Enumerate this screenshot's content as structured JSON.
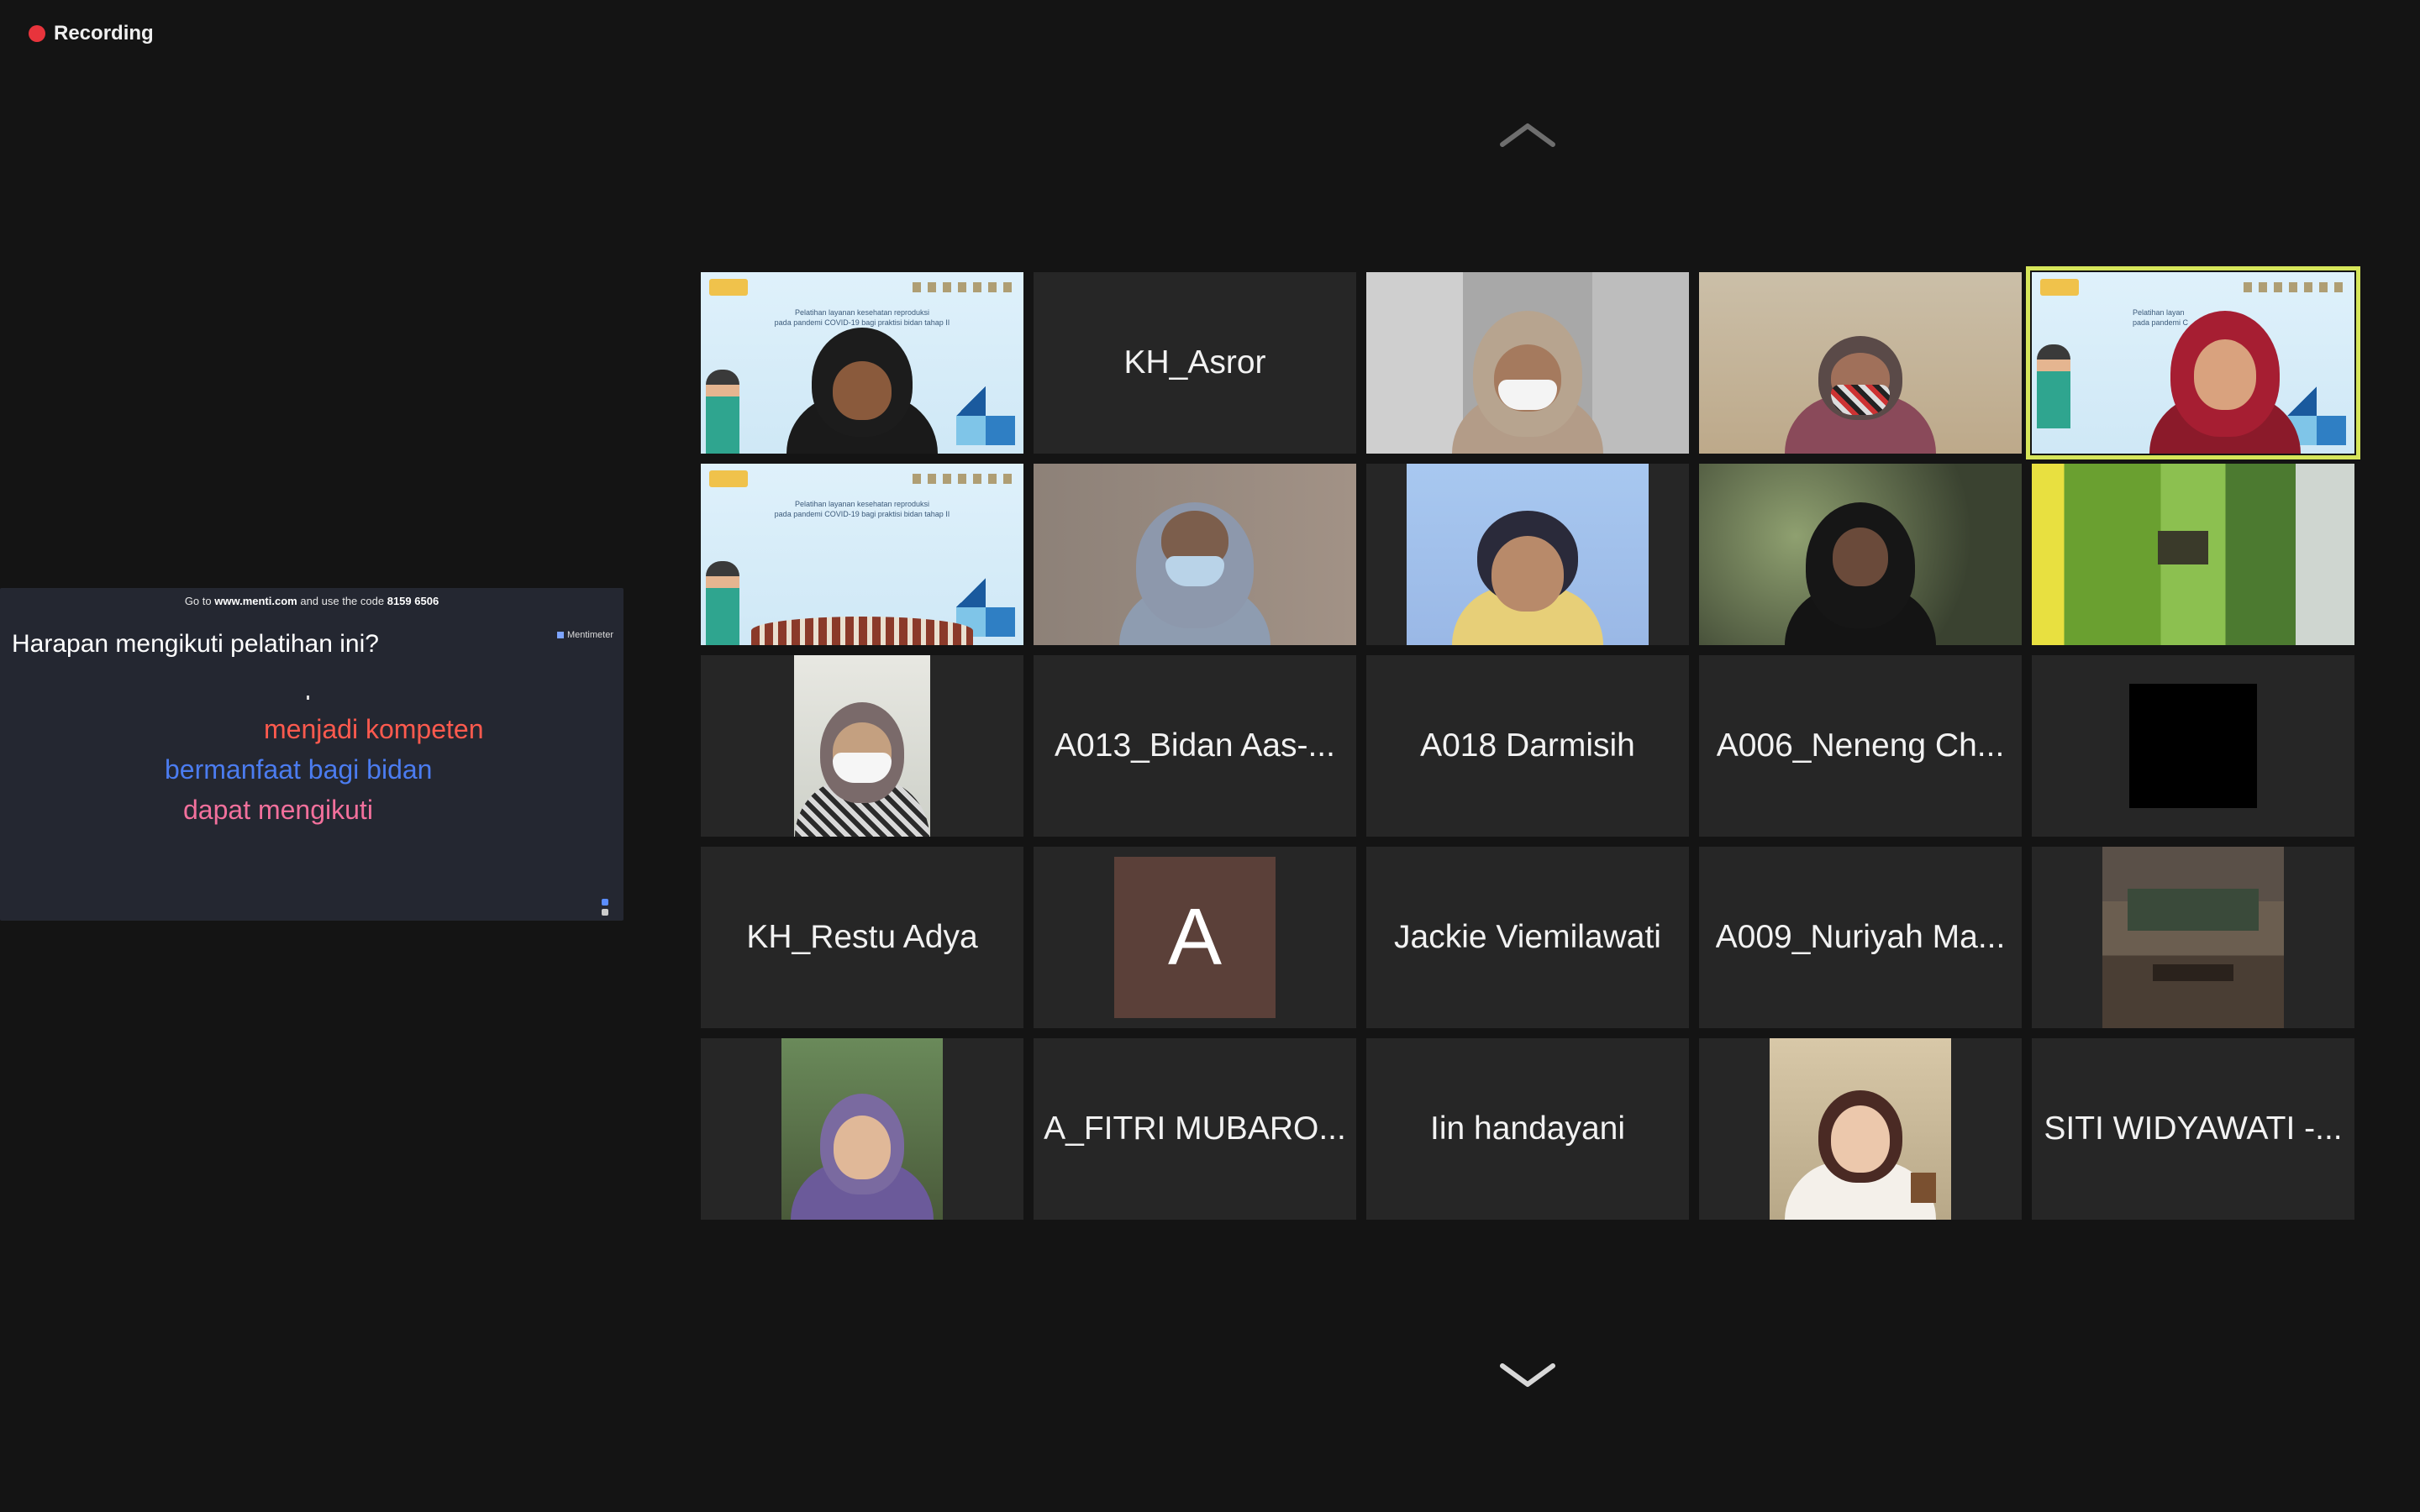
{
  "recording": {
    "label": "Recording",
    "dot_color": "#e8343c"
  },
  "pagination": {
    "up_icon": "chevron-up-icon",
    "down_icon": "chevron-down-icon"
  },
  "shared_screen": {
    "code_prefix": "Go to",
    "code_site": "www.menti.com",
    "code_middle": "and use the code",
    "code_value": "8159 6506",
    "brand": "Mentimeter",
    "question": "Harapan mengikuti pelatihan ini?",
    "words": [
      {
        "text": "menjadi kompeten",
        "color": "#ff5a4e"
      },
      {
        "text": "bermanfaat bagi bidan",
        "color": "#4b7cf0"
      },
      {
        "text": "dapat mengikuti",
        "color": "#f2709c"
      }
    ]
  },
  "gallery": {
    "active_speaker_color": "#d6e65a",
    "tiles": [
      {
        "kind": "video",
        "scene": "slide-hijab-dark"
      },
      {
        "kind": "name",
        "label": "KH_Asror"
      },
      {
        "kind": "video",
        "scene": "hijab-white-mask"
      },
      {
        "kind": "video",
        "scene": "mask-patterned"
      },
      {
        "kind": "video",
        "scene": "slide-hijab-red",
        "speaking": true
      },
      {
        "kind": "video",
        "scene": "slide-only"
      },
      {
        "kind": "video",
        "scene": "hijab-grey"
      },
      {
        "kind": "video",
        "scene": "woman-glasses"
      },
      {
        "kind": "video",
        "scene": "hijab-black-plants"
      },
      {
        "kind": "video",
        "scene": "green-curtain-room"
      },
      {
        "kind": "photo",
        "scene": "hijab-mask-photo"
      },
      {
        "kind": "name",
        "label": "A013_Bidan Aas-..."
      },
      {
        "kind": "name",
        "label": "A018 Darmisih"
      },
      {
        "kind": "name",
        "label": "A006_Neneng Ch..."
      },
      {
        "kind": "black",
        "scene": "black-square"
      },
      {
        "kind": "name",
        "label": "KH_Restu Adya"
      },
      {
        "kind": "letter",
        "label": "A"
      },
      {
        "kind": "name",
        "label": "Jackie Viemilawati"
      },
      {
        "kind": "name",
        "label": "A009_Nuriyah Ma..."
      },
      {
        "kind": "photo",
        "scene": "interior-photo"
      },
      {
        "kind": "photo",
        "scene": "hijab-selfie-photo"
      },
      {
        "kind": "name",
        "label": "A_FITRI MUBARO..."
      },
      {
        "kind": "name",
        "label": "Iin handayani"
      },
      {
        "kind": "photo",
        "scene": "woman-white-photo"
      },
      {
        "kind": "name",
        "label": "SITI WIDYAWATI -..."
      }
    ]
  }
}
